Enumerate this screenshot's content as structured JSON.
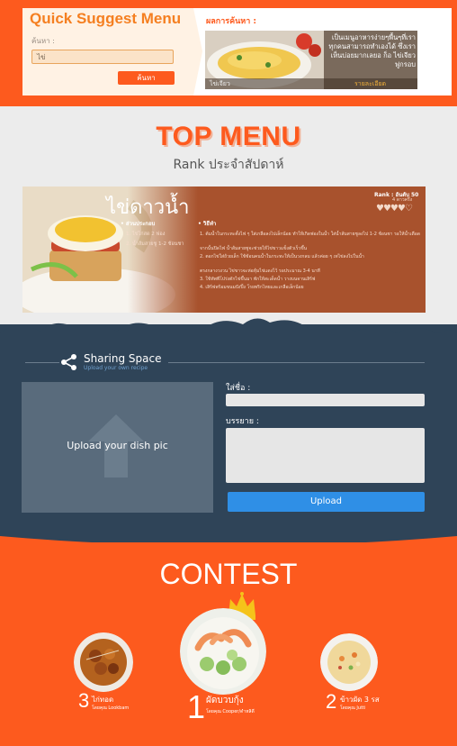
{
  "quick_suggest": {
    "title": "Quick Suggest Menu",
    "search_label": "ค้นหา :",
    "search_value": "ไข่",
    "search_button": "ค้นหา"
  },
  "result": {
    "label": "ผลการค้นหา :",
    "text": "เป็นเมนูอาหารง่ายๆพื้นๆที่เรา ทุกคนสามารถทำเองได้ ซึ่งเรา เห็นบ่อยมากเลยอ ก็อ ไข่เจียวฟูกรอบ",
    "name": "ไข่เจียว",
    "more": "รายละเอียด"
  },
  "top_menu": {
    "title": "TOP MENU",
    "subtitle": "Rank ประจำสัปดาห์"
  },
  "recipe": {
    "name": "ไข่ดาวน้ำ",
    "rank": "Rank : อันดับ 50",
    "rank_sub": "4 ดาวครึ่ง",
    "hearts": "♥♥♥♥♡",
    "ingredients_head": "• ส่วนประกอบ",
    "ingredients": [
      "1. ไข่ไก่สด 2 ฟอง",
      "2. น้ำส้มสายชู 1-2 ช้อนชา"
    ],
    "steps_head": "• วิธีทำ",
    "steps": [
      "1. ต้มน้ำในกระทะตั้งไฟ ๆ ใส่เกลือลงไปเล็กน้อย ทำให้เกิดฟองในน้ำ ใส่น้ำส้มสายชูลงไป 1-2 ช้อนชา รอให้น้ำเดือด",
      "จากนั้นปิดไฟ น้ำส้มสายชูจะช่วยให้ไข่ขาวแข็งตัวเร็วขึ้น",
      "2. ตอกไข่ใส่ถ้วยเล็ก ใช้ช้อนคนน้ำในกระทะให้เป็นวงกลม แล้วค่อย ๆ เทไข่ลงไปในน้ำ",
      "ตรงกลางวงวน ไข่ขาวจะห่อหุ้มไข่แดงไว้ รอประมาณ 3-4 นาที",
      "3. ใช้ทัพพีโปร่งตักไข่ขึ้นมา พักให้สะเด็ดน้ำ วางบนจานเสิร์ฟ",
      "4. เสิร์ฟพร้อมขนมปังปิ้ง โรยพริกไทยและเกลือเล็กน้อย"
    ]
  },
  "sharing": {
    "title": "Sharing Space",
    "subtitle": "Upload your own recipe",
    "upload_text": "Upload your dish pic",
    "name_label": "ใส่ชื่อ :",
    "desc_label": "บรรยาย :",
    "button": "Upload"
  },
  "contest": {
    "title": "CONTEST",
    "entries": [
      {
        "rank": "1",
        "name": "ผัดบวบกุ้ง",
        "by": "โดยคุณ Cooper/ดำหลิดี"
      },
      {
        "rank": "2",
        "name": "ข้าวผัด 3 รส",
        "by": "โดยคุณ Jutti"
      },
      {
        "rank": "3",
        "name": "ไก่ทอด",
        "by": "โดยคุณ Lookbam"
      }
    ]
  },
  "colors": {
    "orange": "#fd5a1e",
    "navy": "#2f4458",
    "accent_blue": "#2f8fe6"
  }
}
